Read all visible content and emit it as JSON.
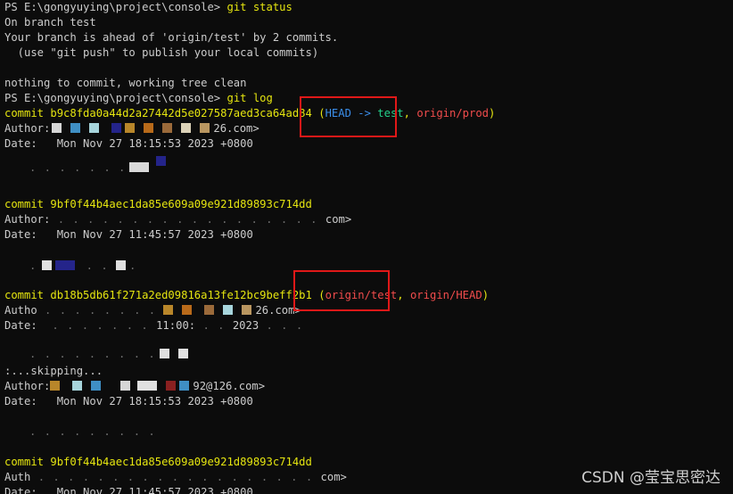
{
  "terminal": {
    "lines": {
      "l1_prompt": "PS E:\\gongyuying\\project\\console> ",
      "l1_cmd": "git status",
      "l2": "On branch test",
      "l3": "Your branch is ahead of 'origin/test' by 2 commits.",
      "l4": "  (use \"git push\" to publish your local commits)",
      "l5": "",
      "l6": "nothing to commit, working tree clean",
      "l7_prompt": "PS E:\\gongyuying\\project\\console> ",
      "l7_cmd": "git log",
      "c1_hash": "commit b9c8fda0a44d2a27442d5e027587aed3ca64ad84",
      "c1_refs_open": " (",
      "c1_ref_head": "HEAD -> ",
      "c1_ref_test": "test",
      "c1_ref_sep": ", ",
      "c1_ref_prod": "origin/prod",
      "c1_refs_close": ")",
      "c1_author_label": "Author:",
      "c1_author_tail": "26.com>",
      "c1_date": "Date:   Mon Nov 27 18:15:53 2023 +0800",
      "c2_hash": "commit 9bf0f44b4aec1da85e609a09e921d89893c714dd",
      "c2_author_label": "Author:",
      "c2_author_tail": "com>",
      "c2_date": "Date:   Mon Nov 27 11:45:57 2023 +0800",
      "c3_hash": "commit db18b5db61f271a2ed09816a13fe12bc9beff2b1",
      "c3_refs_open": " (",
      "c3_ref_test": "origin/test",
      "c3_ref_sep": ", ",
      "c3_ref_head": "origin/HEAD",
      "c3_refs_close": ")",
      "c3_author_label": "Autho",
      "c3_author_tail": "26.com>",
      "c3_date_label": "Date:",
      "c3_date_time": "11:00:",
      "c3_date_year": "2023",
      "skipping": ":...skipping...",
      "c4_author_label": "Author:",
      "c4_author_tail": "92@126.com>",
      "c4_date": "Date:   Mon Nov 27 18:15:53 2023 +0800",
      "c5_hash": "commit 9bf0f44b4aec1da85e609a09e921d89893c714dd",
      "c5_author_label": "Auth",
      "c5_author_tail": "com>",
      "c5_date": "Date:   Mon Nov 27 11:45:57 2023 +0800"
    }
  },
  "watermark": "CSDN @莹宝思密达",
  "colors": {
    "background": "#0c0c0c",
    "text": "#cccccc",
    "commit_yellow": "#e5e510",
    "head_cyan": "#3b8eea",
    "branch_green": "#23d18b",
    "remote_red": "#f14c4c",
    "highlight_box": "#e01818"
  }
}
